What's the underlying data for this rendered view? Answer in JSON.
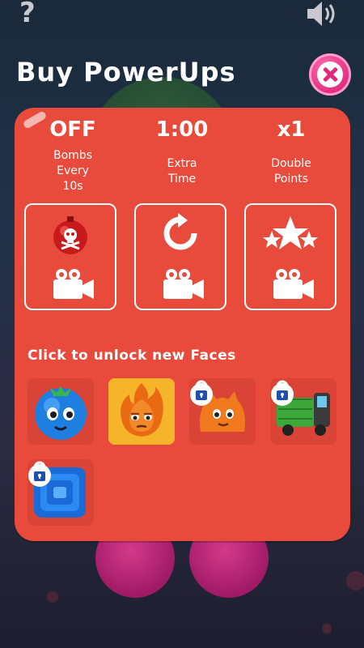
{
  "header": {
    "title": "Buy PowerUps"
  },
  "powerups": [
    {
      "value": "OFF",
      "label_lines": [
        "Bombs",
        "Every",
        "10s"
      ],
      "icon": "bomb-skull-icon"
    },
    {
      "value": "1:00",
      "label_lines": [
        "Extra",
        "Time"
      ],
      "icon": "refresh-icon"
    },
    {
      "value": "x1",
      "label_lines": [
        "Double",
        "Points"
      ],
      "icon": "stars-icon"
    }
  ],
  "unlock": {
    "label": "Click to unlock new Faces"
  },
  "faces": [
    {
      "icon": "blueberry-face-icon",
      "locked": false
    },
    {
      "icon": "fire-face-icon",
      "locked": false,
      "selected": true
    },
    {
      "icon": "orange-blob-face-icon",
      "locked": true
    },
    {
      "icon": "green-truck-face-icon",
      "locked": true
    },
    {
      "icon": "blue-square-face-icon",
      "locked": true
    }
  ],
  "colors": {
    "panel": "#e84a3c",
    "close": "#e2287a",
    "text": "#ffffff"
  }
}
